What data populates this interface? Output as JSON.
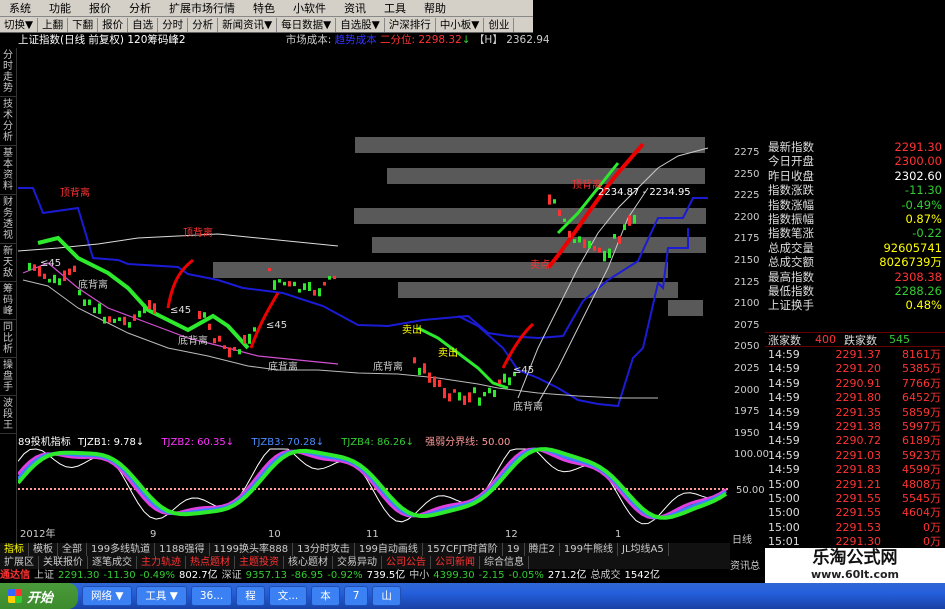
{
  "menubar": {
    "items": [
      "系统",
      "功能",
      "报价",
      "分析",
      "扩展市场行情",
      "特色",
      "小软件",
      "资讯",
      "工具",
      "帮助"
    ]
  },
  "toolbar": {
    "items": [
      "切换▼",
      "上翻",
      "下翻",
      "报价",
      "自选",
      "分时",
      "分析",
      "新闻资讯▼",
      "每日数据▼",
      "自选股▼",
      "沪深排行",
      "中小板▼",
      "创业"
    ]
  },
  "title": {
    "name": "上证指数(日线 前复权) 120筹码峰2",
    "cost_label": "市场成本:",
    "cost_blue": "趋势成本",
    "erfen_label": "二分位:",
    "erfen_value": "2298.32",
    "h_label": "【H】",
    "h_value": "2362.94"
  },
  "leftbar": {
    "items": [
      "分时走势",
      "技术分析",
      "基本资料",
      "财务透视",
      "新天敌",
      "筹码峰",
      "同比析",
      "操盘手",
      "波段王"
    ]
  },
  "chart_labels": {
    "top_label1": "顶背离",
    "top_label2": "顶背离",
    "top_label3": "顶背离",
    "bottom_label1": "底背离",
    "bottom_label2": "底背离",
    "bottom_label3": "底背离",
    "bottom_label4": "底背离",
    "bottom_label5": "底背离",
    "s45a": "≤45",
    "s45b": "≤45",
    "s45c": "≤45",
    "s45d": "≤45",
    "price_line": "2234.87 - 2234.95",
    "buy1": "卖出",
    "buy2": "卖出",
    "buy3": "卖点"
  },
  "price_axis": [
    "2275",
    "2250",
    "2225",
    "2200",
    "2175",
    "2150",
    "2125",
    "2100",
    "2075",
    "2050",
    "2025",
    "2000",
    "1975",
    "1950"
  ],
  "quote": {
    "rows": [
      {
        "label": "最新指数",
        "value": "2291.30",
        "color": "red"
      },
      {
        "label": "今日开盘",
        "value": "2300.00",
        "color": "red"
      },
      {
        "label": "昨日收盘",
        "value": "2302.60",
        "color": "wht"
      },
      {
        "label": "指数涨跌",
        "value": "-11.30",
        "color": "grn"
      },
      {
        "label": "指数涨幅",
        "value": "-0.49%",
        "color": "grn"
      },
      {
        "label": "指数振幅",
        "value": "0.87%",
        "color": "yel"
      },
      {
        "label": "指数笔涨",
        "value": "-0.22",
        "color": "grn"
      },
      {
        "label": "总成交量",
        "value": "92605741",
        "color": "yel"
      },
      {
        "label": "总成交额",
        "value": "8026739万",
        "color": "yel"
      },
      {
        "label": "最高指数",
        "value": "2308.38",
        "color": "red"
      },
      {
        "label": "最低指数",
        "value": "2288.26",
        "color": "grn"
      },
      {
        "label": "上证换手",
        "value": "0.48%",
        "color": "yel"
      }
    ]
  },
  "advance": {
    "up_label": "涨家数",
    "up": "400",
    "down_label": "跌家数",
    "down": "545"
  },
  "ticks": [
    [
      "14:59",
      "2291.37",
      "8161万"
    ],
    [
      "14:59",
      "2291.20",
      "5385万"
    ],
    [
      "14:59",
      "2290.91",
      "7766万"
    ],
    [
      "14:59",
      "2291.80",
      "6452万"
    ],
    [
      "14:59",
      "2291.35",
      "5859万"
    ],
    [
      "14:59",
      "2291.38",
      "5997万"
    ],
    [
      "14:59",
      "2290.72",
      "6189万"
    ],
    [
      "14:59",
      "2291.03",
      "5923万"
    ],
    [
      "14:59",
      "2291.83",
      "4599万"
    ],
    [
      "15:00",
      "2291.21",
      "4808万"
    ],
    [
      "15:00",
      "2291.55",
      "5545万"
    ],
    [
      "15:00",
      "2291.55",
      "4604万"
    ],
    [
      "15:00",
      "2291.53",
      "0万"
    ],
    [
      "15:01",
      "2291.30",
      "0万"
    ]
  ],
  "indicator": {
    "name": "89投机指标",
    "tj1_label": "TJZB1: ",
    "tj1": "9.78",
    "tj2_label": "TJZB2: ",
    "tj2": "60.35",
    "tj3_label": "TJZB3: ",
    "tj3": "70.28",
    "tj4_label": "TJZB4: ",
    "tj4": "86.26",
    "line_label": "强弱分界线: ",
    "line": "50.00",
    "axis": [
      "100.00",
      "50.00"
    ]
  },
  "dates": [
    "2012年",
    "9",
    "10",
    "11",
    "12",
    "1"
  ],
  "tabs1": [
    "指标",
    "模板",
    "全部",
    "199多线轨道",
    "1188强得",
    "1199换头率888",
    "13分时攻击",
    "199自动画线",
    "157CFJT时首阶",
    "19",
    "腾庄2",
    "199牛熊线",
    "JL均线A5"
  ],
  "tabs2": [
    "扩展区",
    "关联报价",
    "逐笔成交",
    "主力轨迹",
    "热点题材",
    "主题投资",
    "核心题材",
    "交易异动",
    "公司公告",
    "公司新闻",
    "综合信息"
  ],
  "rightlabels": {
    "r1": "日线",
    "r2": "资讯总"
  },
  "status": {
    "brand": "通达信",
    "sh_label": "上证",
    "sh": "2291.30",
    "sh_chg": "-11.30",
    "sh_pct": "-0.49%",
    "sh_amt": "802.7亿",
    "sz_label": "深证",
    "sz": "9357.13",
    "sz_chg": "-86.95",
    "sz_pct": "-0.92%",
    "sz_amt": "739.5亿",
    "zx_label": "中小",
    "zx": "4399.30",
    "zx_chg": "-2.15",
    "zx_pct": "-0.05%",
    "zx_amt": "271.2亿",
    "total_label": "总成交",
    "total": "1542亿"
  },
  "taskbar": {
    "start": "开始",
    "buttons": [
      "网络 ▼",
      "工具 ▼",
      "36...",
      "程",
      "文...",
      "本",
      "7",
      "山"
    ]
  },
  "watermark": {
    "line1": "乐淘公式网",
    "line2": "www.60lt.com"
  }
}
